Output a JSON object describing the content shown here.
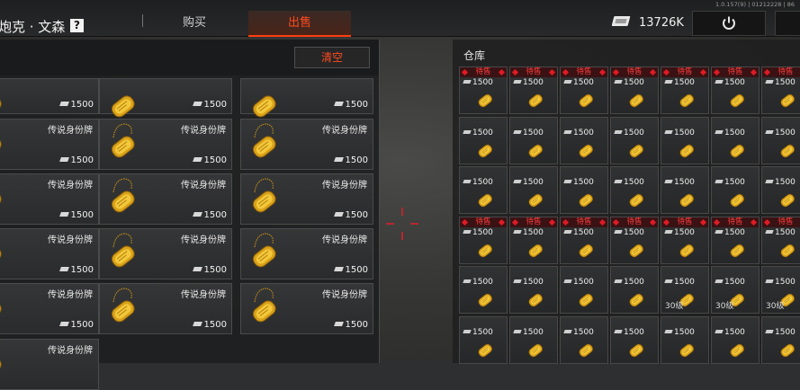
{
  "header": {
    "title": "炮克 · 文森",
    "help_label": "?",
    "tabs": [
      {
        "label": "购买",
        "active": false
      },
      {
        "label": "出售",
        "active": true
      }
    ],
    "balance": "13726K",
    "version": "1.0.157(9) | 01212228 | 86"
  },
  "left_panel": {
    "clear_label": "清空",
    "items": [
      {
        "name": "",
        "price": "1500"
      },
      {
        "name": "",
        "price": "1500"
      },
      {
        "name": "",
        "price": "1500"
      },
      {
        "name": "传说身份牌",
        "price": "1500"
      },
      {
        "name": "传说身份牌",
        "price": "1500"
      },
      {
        "name": "传说身份牌",
        "price": "1500"
      },
      {
        "name": "传说身份牌",
        "price": "1500"
      },
      {
        "name": "传说身份牌",
        "price": "1500"
      },
      {
        "name": "传说身份牌",
        "price": "1500"
      },
      {
        "name": "传说身份牌",
        "price": "1500"
      },
      {
        "name": "传说身份牌",
        "price": "1500"
      },
      {
        "name": "传说身份牌",
        "price": "1500"
      },
      {
        "name": "传说身份牌",
        "price": "1500"
      },
      {
        "name": "传说身份牌",
        "price": "1500"
      },
      {
        "name": "传说身份牌",
        "price": "1500"
      },
      {
        "name": "传说身份牌",
        "price": ""
      }
    ]
  },
  "warehouse": {
    "title": "仓库",
    "pending_label": "待售",
    "rows": [
      [
        "1500",
        "1500",
        "1500",
        "1500",
        "1500",
        "1500",
        "1500"
      ],
      [
        "1500",
        "1500",
        "1500",
        "1500",
        "1500",
        "1500",
        "1500"
      ],
      [
        "1500",
        "1500",
        "1500",
        "1500",
        "1500",
        "1500",
        "1500"
      ],
      [
        "1500",
        "1500",
        "1500",
        "1500",
        "1500",
        "1500",
        "1500"
      ],
      [
        "1500",
        "1500",
        "1500",
        "1500",
        "1500",
        "1500",
        "1500"
      ],
      [
        "1500",
        "1500",
        "1500",
        "1500",
        "1500",
        "1500",
        "1500"
      ]
    ],
    "level_label": "30级"
  },
  "colors": {
    "accent": "#ff4a20",
    "pending_red": "#e01b24",
    "gold": "#e0a818"
  }
}
